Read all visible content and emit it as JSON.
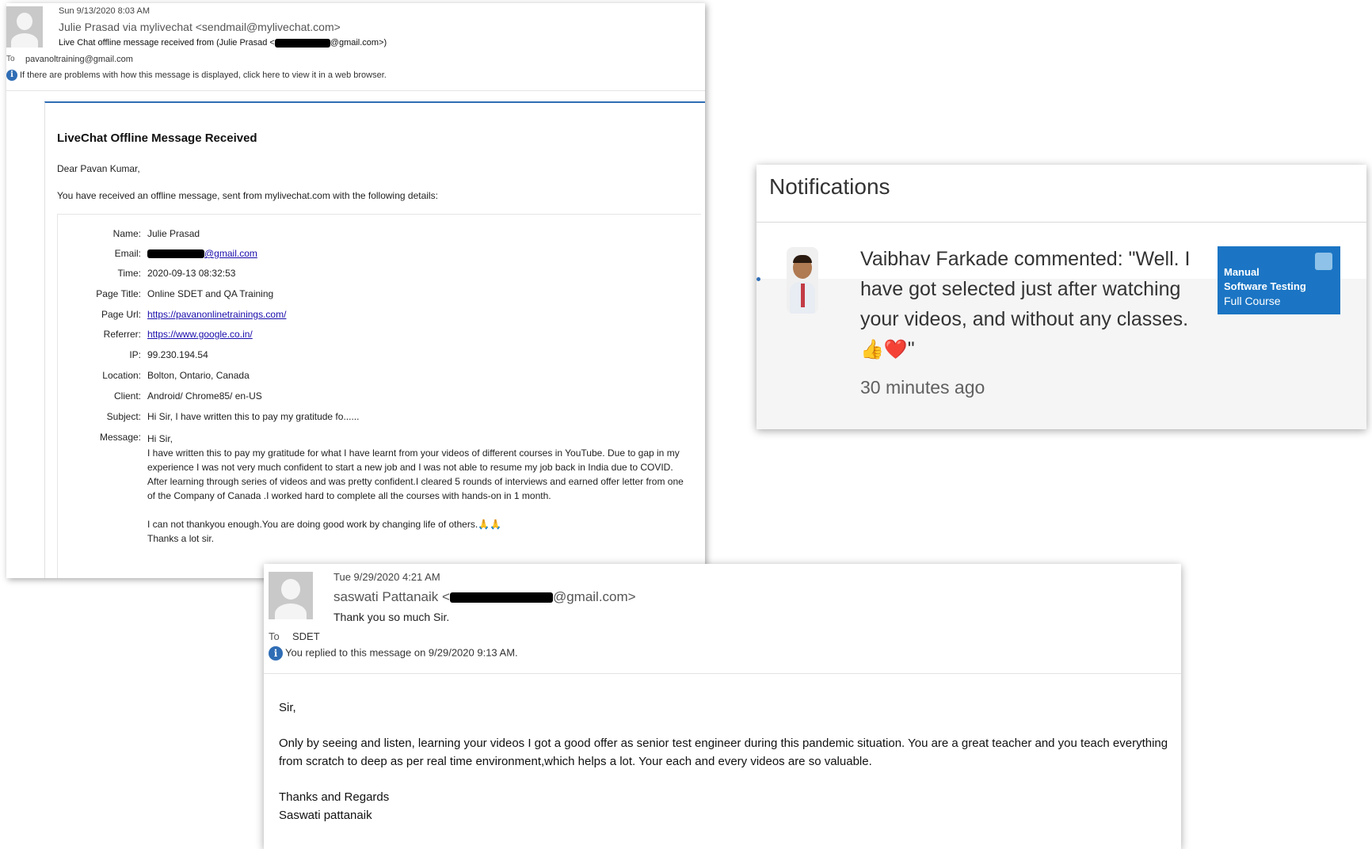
{
  "email1": {
    "date": "Sun 9/13/2020 8:03 AM",
    "from": "Julie Prasad via mylivechat <sendmail@mylivechat.com>",
    "subject_prefix": "Live Chat offline message received from (Julie Prasad <",
    "subject_suffix": "@gmail.com>)",
    "to_label": "To",
    "to": "pavanoltraining@gmail.com",
    "info": "If there are problems with how this message is displayed, click here to view it in a web browser.",
    "heading": "LiveChat Offline Message Received",
    "greeting": "Dear Pavan Kumar,",
    "intro": "You have received an offline message, sent from mylivechat.com with the following details:",
    "details": {
      "name": {
        "label": "Name:",
        "value": "Julie Prasad"
      },
      "email": {
        "label": "Email:",
        "value_suffix": "@gmail.com"
      },
      "time": {
        "label": "Time:",
        "value": "2020-09-13 08:32:53"
      },
      "page_title": {
        "label": "Page Title:",
        "value": "Online SDET and QA Training"
      },
      "page_url": {
        "label": "Page Url:",
        "value": "https://pavanonlinetrainings.com/"
      },
      "referrer": {
        "label": "Referrer:",
        "value": "https://www.google.co.in/"
      },
      "ip": {
        "label": "IP:",
        "value": "99.230.194.54"
      },
      "location": {
        "label": "Location:",
        "value": "Bolton, Ontario, Canada"
      },
      "client": {
        "label": "Client:",
        "value": "Android/ Chrome85/ en-US"
      },
      "subject": {
        "label": "Subject:",
        "value": "Hi Sir, I have written this to pay my gratitude fo......"
      },
      "message": {
        "label": "Message:"
      }
    },
    "message": {
      "line1": "Hi Sir,",
      "para1": "I have written this to pay my gratitude for what I have learnt from your videos of different courses in YouTube. Due to gap in my experience I was not very much confident to start a new job and I was not able to resume my job back in India due to COVID. After learning through series of videos and was pretty confident.I cleared 5 rounds of interviews and earned offer letter from one of the Company of Canada .I worked hard to complete all the courses with hands-on in 1 month.",
      "para2": "I can not thankyou enough.You are doing good work by changing life of others.🙏🙏",
      "closing": "Thanks a lot sir."
    }
  },
  "notifications": {
    "title": "Notifications",
    "item": {
      "text": "Vaibhav Farkade commented: \"Well. I have got selected just after watching your videos, and without any classes.",
      "emoji": "👍❤️",
      "quote_close": "\"",
      "time": "30 minutes ago",
      "thumb_line1": "Manual",
      "thumb_line2": "Software Testing",
      "thumb_line3": "Full Course"
    }
  },
  "email2": {
    "date": "Tue 9/29/2020 4:21 AM",
    "from_prefix": "saswati Pattanaik <",
    "from_suffix": "@gmail.com>",
    "subject": "Thank you so much Sir.",
    "to_label": "To",
    "to": "SDET",
    "info": "You replied to this message on 9/29/2020 9:13 AM.",
    "body": {
      "salutation": "Sir,",
      "para": "Only by seeing and listen, learning your videos I got a good offer as senior test engineer during this pandemic situation. You are a great teacher and you teach everything from scratch to deep as per real time environment,which helps a lot. Your each and every videos are so valuable.",
      "signoff1": "Thanks and Regards",
      "signoff2": "Saswati pattanaik"
    }
  }
}
